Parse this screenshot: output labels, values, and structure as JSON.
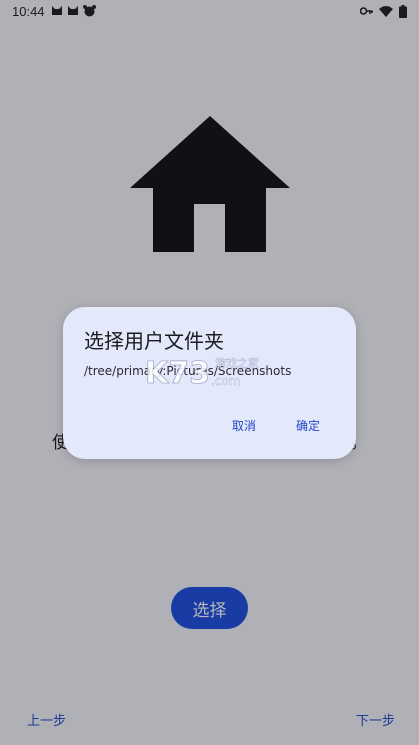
{
  "status_bar": {
    "time": "10:44",
    "left_icons": [
      "cat-icon",
      "cat-icon",
      "animal-face-icon"
    ],
    "right_icons": [
      "key-icon",
      "wifi-icon",
      "battery-icon"
    ]
  },
  "page": {
    "illustration": "house-icon",
    "behind_text_left": "使",
    "behind_text_right": "。",
    "select_button": "选择",
    "prev": "上一步",
    "next": "下一步"
  },
  "dialog": {
    "title": "选择用户文件夹",
    "path": "/tree/primary:Pictures/Screenshots",
    "watermark_brand": "K73",
    "watermark_text": "游戏之家",
    "watermark_domain": ".com",
    "cancel": "取消",
    "confirm": "确定"
  },
  "colors": {
    "accent": "#1a4de0",
    "link": "#2348c9",
    "dialog_bg": "#e4e8fb",
    "scrim": "rgba(20,20,25,0.30)"
  }
}
